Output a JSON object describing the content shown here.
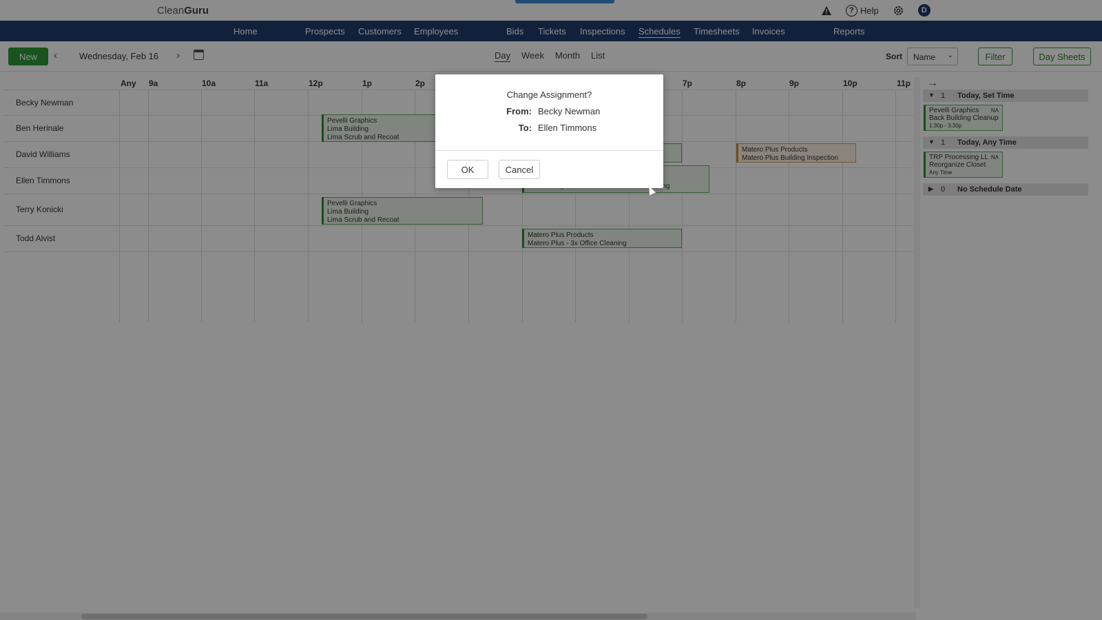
{
  "app": {
    "logo_light": "Clean",
    "logo_bold": "Guru"
  },
  "top_icons": {
    "help_label": "Help",
    "avatar_initial": "D"
  },
  "nav": {
    "items": [
      "Home",
      "Prospects",
      "Customers",
      "Employees",
      "Bids",
      "Tickets",
      "Inspections",
      "Schedules",
      "Timesheets",
      "Invoices",
      "Reports"
    ],
    "active": "Schedules"
  },
  "toolbar": {
    "new_label": "New",
    "date": "Wednesday, Feb 16",
    "views": [
      "Day",
      "Week",
      "Month",
      "List"
    ],
    "active_view": "Day",
    "sort_label": "Sort",
    "sort_value": "Name",
    "filter_label": "Filter",
    "day_sheets_label": "Day Sheets"
  },
  "grid": {
    "hours": [
      "Any",
      "9a",
      "10a",
      "11a",
      "12p",
      "1p",
      "2p",
      "7p",
      "8p",
      "9p",
      "10p",
      "11p"
    ],
    "employees": [
      "Becky Newman",
      "Ben Herinale",
      "David Williams",
      "Ellen Timmons",
      "Terry Konicki",
      "Todd Alvist"
    ],
    "jobs": [
      {
        "lines": [
          "Pevelli Graphics",
          "Lima Building",
          "Lima Scrub and Recoat"
        ],
        "employee": "Ben Herinale"
      },
      {
        "lines": [
          "Matero Plus Products",
          "Matero Plus Building Inspection"
        ],
        "employee": "David Williams",
        "status": "orange"
      },
      {
        "lines": [
          "Pevelli Graphics Tiffin 3x/week Office Cleaning"
        ],
        "employee": "Ellen Timmons"
      },
      {
        "lines": [
          "Pevelli Graphics",
          "Lima Building",
          "Lima Scrub and Recoat"
        ],
        "employee": "Terry Konicki"
      },
      {
        "lines": [
          "Matero Plus Products",
          "Matero Plus - 3x Office Cleaning"
        ],
        "employee": "Todd Alvist"
      }
    ]
  },
  "side_panel": {
    "groups": [
      {
        "count": "1",
        "title": "Today, Set Time",
        "expanded": true
      },
      {
        "count": "1",
        "title": "Today, Any Time",
        "expanded": true
      },
      {
        "count": "0",
        "title": "No Schedule Date",
        "expanded": false
      }
    ],
    "cards": [
      {
        "line1": "Pevelli Graphics",
        "line2": "Back Building Cleanup",
        "line3": "1:30p - 3:30p",
        "tag": "NA"
      },
      {
        "line1": "TRP Processing LL",
        "line2": "Reorganize Closet",
        "line3": "Any Time",
        "tag": "NA"
      }
    ]
  },
  "dialog": {
    "title": "Change Assignment?",
    "from_label": "From:",
    "from_value": "Becky Newman",
    "to_label": "To:",
    "to_value": "Ellen Timmons",
    "ok_label": "OK",
    "cancel_label": "Cancel"
  },
  "colors": {
    "nav": "#1f3d6e",
    "primary_green": "#2e9a3a",
    "job_orange": "#d7872f"
  }
}
